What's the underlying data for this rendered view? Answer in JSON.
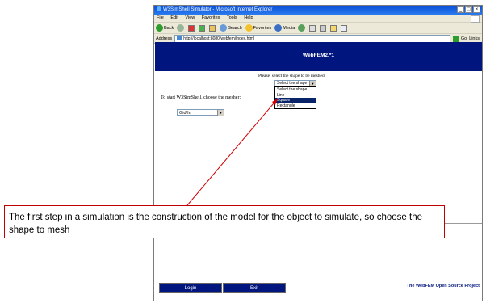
{
  "window": {
    "title": "W3SimShell Simulator - Microsoft Internet Explorer",
    "controls": [
      "_",
      "□",
      "×"
    ]
  },
  "menubar": {
    "items": [
      "File",
      "Edit",
      "View",
      "Favorites",
      "Tools",
      "Help"
    ]
  },
  "toolbar": {
    "back": "Back",
    "search": "Search",
    "favorites": "Favorites",
    "media": "Media"
  },
  "addressbar": {
    "label": "Address",
    "url": "http://localhost:8080/webfem/index.html",
    "go": "Go",
    "links": "Links"
  },
  "app": {
    "header_title": "WebFEM2.*1",
    "start_text": "To start W3SimShell, choose the mesher:",
    "mesher_selected": "Gid/In",
    "shape_prompt": "Please, select the shape to be meshed",
    "shape_selected": "Select the shape",
    "shape_options": [
      "Select the shape",
      "Line",
      "Square",
      "Rectangle"
    ],
    "shape_highlighted_index": 2,
    "login_label": "Login",
    "exit_label": "Exit",
    "project_link": "The WebFEM Open Source Project"
  },
  "callout": {
    "text": "The first step in a simulation is the construction of the model for the object to simulate, so choose the shape to mesh",
    "color": "#c00000"
  },
  "colors": {
    "header_blue": "#00157d",
    "highlight": "#0a246a"
  }
}
